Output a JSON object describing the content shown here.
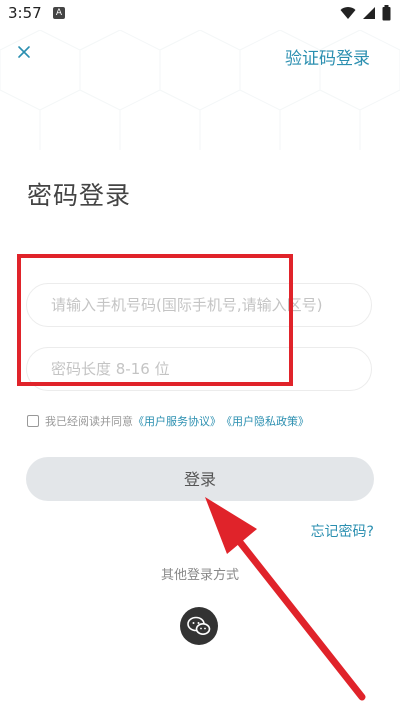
{
  "status_bar": {
    "time": "3:57",
    "notification_letter": "A"
  },
  "header": {
    "sms_login_label": "验证码登录"
  },
  "page_title": "密码登录",
  "form": {
    "phone_placeholder": "请输入手机号码(国际手机号,请输入区号)",
    "phone_value": "",
    "password_placeholder": "密码长度 8-16 位",
    "password_value": ""
  },
  "agreement": {
    "checked": false,
    "prefix": "我已经阅读并同意",
    "service_link": "《用户服务协议》",
    "privacy_link": "《用户隐私政策》"
  },
  "login_button_label": "登录",
  "forgot_password_label": "忘记密码?",
  "other_login_label": "其他登录方式",
  "colors": {
    "accent": "#2b8fb0",
    "highlight": "#e0232a",
    "button_bg": "#e3e6e9"
  },
  "icons": [
    "close-icon",
    "wifi-icon",
    "signal-icon",
    "battery-icon",
    "wechat-icon"
  ]
}
